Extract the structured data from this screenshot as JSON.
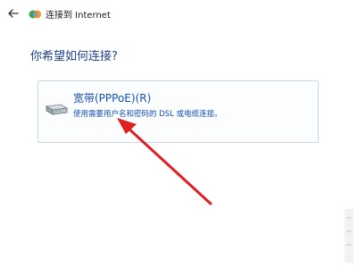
{
  "window": {
    "title": "连接到 Internet",
    "back_icon": "back-arrow-icon",
    "app_icon": "network-globe-icon"
  },
  "prompt": "你希望如何连接?",
  "option": {
    "title": "宽带(PPPoE)(R)",
    "description": "使用需要用户名和密码的 DSL 或电缆连接。",
    "icon": "modem-icon"
  },
  "colors": {
    "prompt_blue": "#1f3f8f",
    "link_blue": "#1450b8",
    "card_border": "#c9d8e6",
    "annotation_red": "#e02020"
  }
}
